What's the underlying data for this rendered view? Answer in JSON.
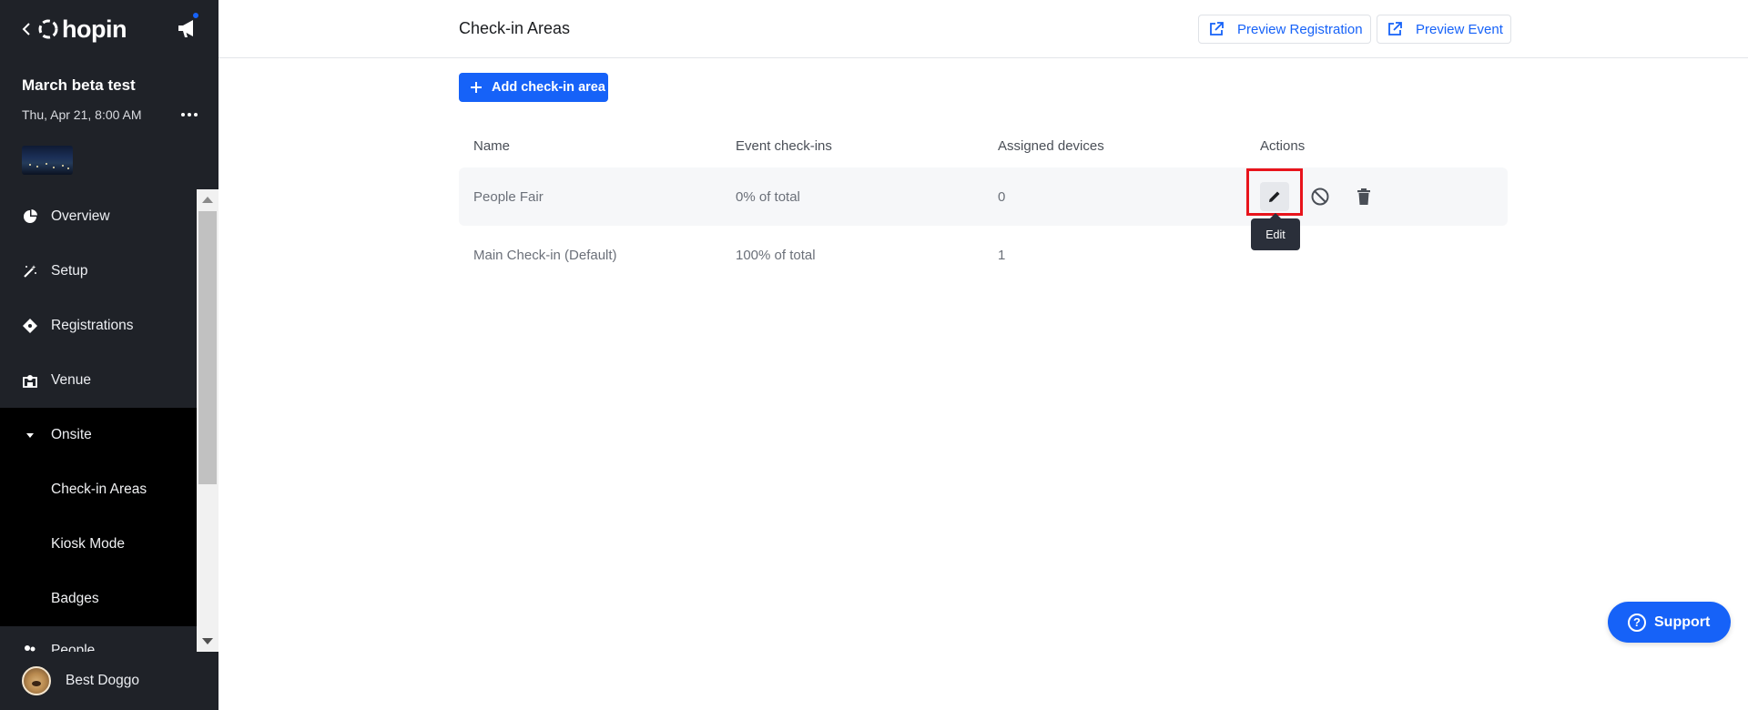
{
  "sidebar": {
    "logo_text": "hopin",
    "event_title": "March beta test",
    "event_date": "Thu, Apr 21, 8:00 AM",
    "nav": [
      {
        "label": "Overview",
        "icon": "pie-chart-icon"
      },
      {
        "label": "Setup",
        "icon": "magic-wand-icon"
      },
      {
        "label": "Registrations",
        "icon": "ticket-icon"
      },
      {
        "label": "Venue",
        "icon": "venue-icon"
      },
      {
        "label": "Onsite",
        "icon": "caret-down-icon"
      }
    ],
    "onsite_sub": [
      "Check-in Areas",
      "Kiosk Mode",
      "Badges"
    ],
    "partial_item": "People",
    "user_name": "Best Doggo"
  },
  "header": {
    "title": "Check-in Areas",
    "preview_registration": "Preview Registration",
    "preview_event": "Preview Event"
  },
  "main": {
    "add_button": "Add check-in area",
    "columns": [
      "Name",
      "Event check-ins",
      "Assigned devices",
      "Actions"
    ],
    "rows": [
      {
        "name": "People Fair",
        "checkins": "0% of total",
        "devices": "0"
      },
      {
        "name": "Main Check-in (Default)",
        "checkins": "100% of total",
        "devices": "1"
      }
    ],
    "tooltip": "Edit"
  },
  "support_label": "Support",
  "colors": {
    "accent": "#1662f8",
    "sidebar_bg": "#1f2228",
    "highlight": "#e8141c"
  }
}
